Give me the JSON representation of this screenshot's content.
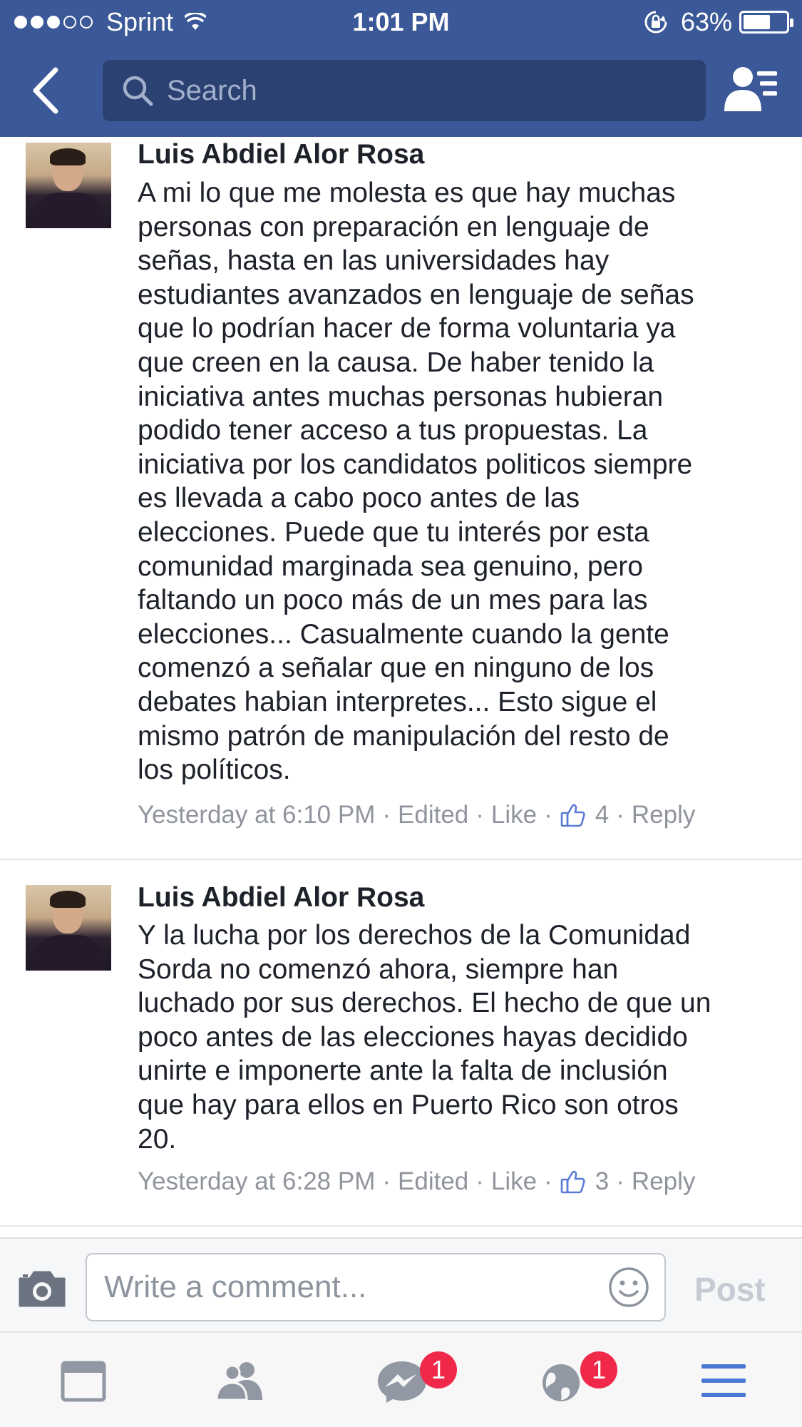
{
  "status_bar": {
    "carrier": "Sprint",
    "time": "1:01 PM",
    "battery": "63%",
    "battery_level": 0.63
  },
  "header": {
    "search_placeholder": "Search",
    "icons": [
      "back-icon",
      "search-icon",
      "friend-requests-icon"
    ]
  },
  "comments": [
    {
      "author": "Luis Abdiel Alor Rosa",
      "lines": [
        "A mi lo que me molesta es que hay muchas",
        "personas con preparación en lenguaje de",
        "señas, hasta en las universidades hay",
        "estudiantes avanzados en lenguaje de señas",
        "que lo podrían hacer de forma voluntaria ya",
        "que creen en la causa. De haber tenido la",
        "iniciativa antes muchas personas hubieran",
        "podido tener acceso a tus propuestas. La",
        "iniciativa por los candidatos politicos siempre",
        "es llevada a cabo poco antes de las",
        "elecciones. Puede que tu interés por esta",
        "comunidad marginada sea genuino, pero",
        "faltando un poco más de un mes para las",
        "elecciones... Casualmente cuando la gente",
        "comenzó a señalar que en ninguno de los",
        "debates habian interpretes... Esto sigue el",
        "mismo patrón de manipulación del resto de",
        "los políticos."
      ],
      "timestamp": "Yesterday at 6:10 PM",
      "edited": "Edited",
      "like": "Like",
      "likes": "4",
      "reply": "Reply"
    },
    {
      "author": "Luis Abdiel Alor Rosa",
      "lines": [
        "Y la lucha por los derechos de la Comunidad",
        "Sorda no comenzó ahora, siempre han",
        "luchado por sus derechos. El hecho de que un",
        "poco antes de las elecciones hayas decidido",
        "unirte e imponerte ante la falta de inclusión",
        "que hay para ellos en Puerto Rico son otros",
        "20."
      ],
      "timestamp": "Yesterday at 6:28 PM",
      "edited": "Edited",
      "like": "Like",
      "likes": "3",
      "reply": "Reply"
    }
  ],
  "composer": {
    "placeholder": "Write a comment...",
    "post_label": "Post"
  },
  "tabbar": {
    "tabs": [
      {
        "icon": "news-feed-icon"
      },
      {
        "icon": "friends-icon"
      },
      {
        "icon": "messenger-icon",
        "badge": "1"
      },
      {
        "icon": "notifications-globe-icon",
        "badge": "1"
      },
      {
        "icon": "menu-icon"
      }
    ]
  },
  "colors": {
    "brand": "#3b5998",
    "search_bg": "#2b4172",
    "badge": "#f02849",
    "meta_text": "#90949c",
    "active_tab": "#4a76d4"
  }
}
